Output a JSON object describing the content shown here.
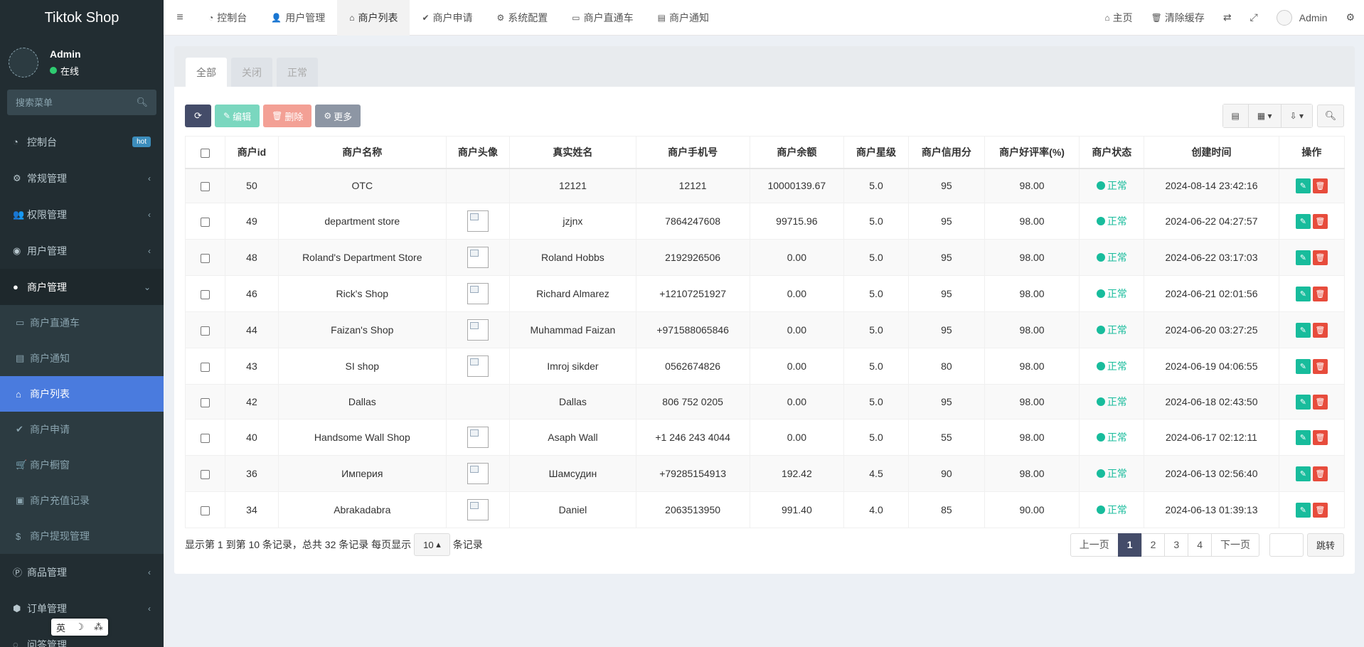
{
  "app": {
    "title": "Tiktok Shop"
  },
  "user": {
    "name": "Admin",
    "status": "在线"
  },
  "sidebar": {
    "search_placeholder": "搜索菜单",
    "items": [
      {
        "label": "控制台",
        "icon": "dashboard-icon",
        "glyph": "◔",
        "badge": "hot"
      },
      {
        "label": "常规管理",
        "icon": "cogs-icon",
        "glyph": "⚙",
        "chevron": "‹"
      },
      {
        "label": "权限管理",
        "icon": "group-icon",
        "glyph": "👥",
        "chevron": "‹"
      },
      {
        "label": "用户管理",
        "icon": "user-circle-icon",
        "glyph": "◉",
        "chevron": "‹"
      },
      {
        "label": "商户管理",
        "icon": "apple-icon",
        "glyph": "●",
        "chevron": "⌄"
      },
      {
        "label": "商户直通车",
        "icon": "car-icon",
        "glyph": "▭"
      },
      {
        "label": "商户通知",
        "icon": "list-alt-icon",
        "glyph": "▤"
      },
      {
        "label": "商户列表",
        "icon": "home-icon",
        "glyph": "⌂"
      },
      {
        "label": "商户申请",
        "icon": "check-circle-icon",
        "glyph": "✔"
      },
      {
        "label": "商户橱窗",
        "icon": "cart-icon",
        "glyph": "🛒"
      },
      {
        "label": "商户充值记录",
        "icon": "money-icon",
        "glyph": "▣"
      },
      {
        "label": "商户提现管理",
        "icon": "dollar-icon",
        "glyph": "$"
      },
      {
        "label": "商品管理",
        "icon": "product-icon",
        "glyph": "Ⓟ",
        "chevron": "‹"
      },
      {
        "label": "订单管理",
        "icon": "cube-icon",
        "glyph": "⬢",
        "chevron": "‹"
      },
      {
        "label": "问答管理",
        "icon": "question-icon",
        "glyph": "◌"
      }
    ]
  },
  "ime": {
    "a": "英",
    "b": "☽",
    "c": "⁂"
  },
  "header": {
    "tabs": [
      {
        "label": "控制台",
        "glyph": "◔"
      },
      {
        "label": "用户管理",
        "glyph": "👤"
      },
      {
        "label": "商户列表",
        "glyph": "⌂"
      },
      {
        "label": "商户申请",
        "glyph": "✔"
      },
      {
        "label": "系统配置",
        "glyph": "⚙"
      },
      {
        "label": "商户直通车",
        "glyph": "▭"
      },
      {
        "label": "商户通知",
        "glyph": "▤"
      }
    ],
    "home": "主页",
    "clear_cache": "清除缓存",
    "admin": "Admin"
  },
  "content_tabs": [
    "全部",
    "关闭",
    "正常"
  ],
  "toolbar": {
    "edit": "编辑",
    "delete": "删除",
    "more": "更多"
  },
  "table": {
    "columns": [
      "商户id",
      "商户名称",
      "商户头像",
      "真实姓名",
      "商户手机号",
      "商户余额",
      "商户星级",
      "商户信用分",
      "商户好评率(%)",
      "商户状态",
      "创建时间",
      "操作"
    ],
    "rows": [
      {
        "id": "50",
        "name": "OTC",
        "has_avatar": false,
        "real_name": "12121",
        "phone": "12121",
        "balance": "10000139.67",
        "stars": "5.0",
        "credit": "95",
        "rating": "98.00",
        "status": "正常",
        "created": "2024-08-14 23:42:16"
      },
      {
        "id": "49",
        "name": "department store",
        "has_avatar": true,
        "real_name": "jzjnx",
        "phone": "7864247608",
        "balance": "99715.96",
        "stars": "5.0",
        "credit": "95",
        "rating": "98.00",
        "status": "正常",
        "created": "2024-06-22 04:27:57"
      },
      {
        "id": "48",
        "name": "Roland's Department Store",
        "has_avatar": true,
        "real_name": "Roland Hobbs",
        "phone": "2192926506",
        "balance": "0.00",
        "stars": "5.0",
        "credit": "95",
        "rating": "98.00",
        "status": "正常",
        "created": "2024-06-22 03:17:03"
      },
      {
        "id": "46",
        "name": "Rick's Shop",
        "has_avatar": true,
        "real_name": "Richard Almarez",
        "phone": "+12107251927",
        "balance": "0.00",
        "stars": "5.0",
        "credit": "95",
        "rating": "98.00",
        "status": "正常",
        "created": "2024-06-21 02:01:56"
      },
      {
        "id": "44",
        "name": "Faizan's Shop",
        "has_avatar": true,
        "real_name": "Muhammad Faizan",
        "phone": "+971588065846",
        "balance": "0.00",
        "stars": "5.0",
        "credit": "95",
        "rating": "98.00",
        "status": "正常",
        "created": "2024-06-20 03:27:25"
      },
      {
        "id": "43",
        "name": "SI shop",
        "has_avatar": true,
        "real_name": "Imroj sikder",
        "phone": "0562674826",
        "balance": "0.00",
        "stars": "5.0",
        "credit": "80",
        "rating": "98.00",
        "status": "正常",
        "created": "2024-06-19 04:06:55"
      },
      {
        "id": "42",
        "name": "Dallas",
        "has_avatar": false,
        "real_name": "Dallas",
        "phone": "806 752 0205",
        "balance": "0.00",
        "stars": "5.0",
        "credit": "95",
        "rating": "98.00",
        "status": "正常",
        "created": "2024-06-18 02:43:50"
      },
      {
        "id": "40",
        "name": "Handsome Wall Shop",
        "has_avatar": true,
        "real_name": "Asaph Wall",
        "phone": "+1 246 243 4044",
        "balance": "0.00",
        "stars": "5.0",
        "credit": "55",
        "rating": "98.00",
        "status": "正常",
        "created": "2024-06-17 02:12:11"
      },
      {
        "id": "36",
        "name": "Империя",
        "has_avatar": true,
        "real_name": "Шамсудин",
        "phone": "+79285154913",
        "balance": "192.42",
        "stars": "4.5",
        "credit": "90",
        "rating": "98.00",
        "status": "正常",
        "created": "2024-06-13 02:56:40"
      },
      {
        "id": "34",
        "name": "Abrakadabra",
        "has_avatar": true,
        "real_name": "Daniel",
        "phone": "2063513950",
        "balance": "991.40",
        "stars": "4.0",
        "credit": "85",
        "rating": "90.00",
        "status": "正常",
        "created": "2024-06-13 01:39:13"
      }
    ]
  },
  "footer": {
    "summary": "显示第 1 到第 10 条记录，总共 32 条记录 每页显示",
    "page_size": "10",
    "suffix": "条记录",
    "prev": "上一页",
    "pages": [
      "1",
      "2",
      "3",
      "4"
    ],
    "current_page": "1",
    "next": "下一页",
    "jump": "跳转"
  },
  "colors": {
    "sidebar_bg": "#222d32",
    "active_menu": "#4a7bde",
    "status_green": "#18bc9c",
    "delete_red": "#e74c3c",
    "primary_dark": "#444c69"
  }
}
